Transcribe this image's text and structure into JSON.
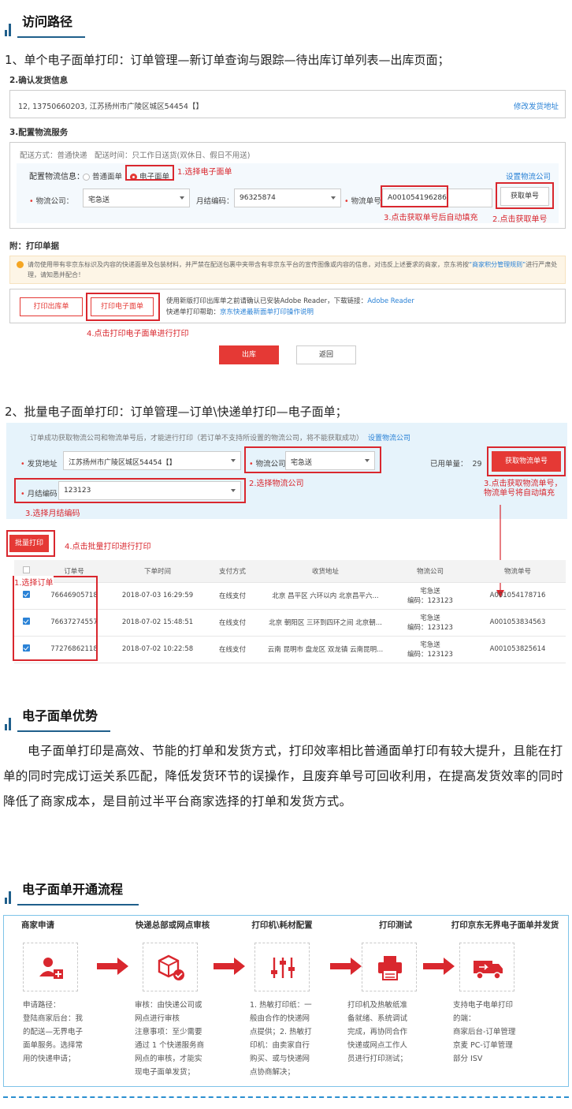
{
  "section1": {
    "title": "访问路径",
    "line1": "1、单个电子面单打印：订单管理—新订单查询与跟踪—待出库订单列表—出库页面；",
    "shot1": {
      "confirm_title": "2.确认发货信息",
      "address": "12, 13750660203, 江苏扬州市广陵区城区54454【】",
      "edit_address": "修改发货地址",
      "logistics_title": "3.配置物流服务",
      "delivery_info": "配送方式：普通快递　配送时间：只工作日送货(双休日、假日不用送)",
      "config_label": "配置物流信息：",
      "radio_normal": "普通面单",
      "radio_e": "电子面单",
      "setup_logistics": "设置物流公司",
      "company_label": "物流公司：",
      "company_value": "宅急送",
      "monthly_label": "月结编码：",
      "monthly_value": "96325874",
      "waybill_label": "物流单号：",
      "waybill_value": "A001054196286",
      "get_number": "获取单号",
      "note1": "1.选择电子面单",
      "note2": "2.点击获取单号",
      "note3": "3.点击获取单号后自动填充",
      "print_title": "附：打印单据",
      "warning": "请勿使用带有非京东标识及内容的快递面单及包装材料，并严禁在配送包裹中夹带含有非京东平台的宣传图像或内容的信息，对违反上述要求的商家，京东将按",
      "warning_link": "“商家积分管理规则”",
      "warning_tail": "进行严肃处理，请知悉并配合！",
      "print_out": "打印出库单",
      "print_e": "打印电子面单",
      "help1": "使用新版打印出库单之前请确认已安装Adobe Reader，下载链接：",
      "help1_link": "Adobe Reader",
      "help2": "快递单打印帮助：",
      "help2_link": "京东快递最新面单打印操作说明",
      "note4": "4.点击打印电子面单进行打印",
      "out_btn": "出库",
      "back_btn": "返回"
    },
    "line2": "2、批量电子面单打印：订单管理—订单\\快递单打印—电子面单；",
    "shot2": {
      "tip": "订单成功获取物流公司和物流单号后，才能进行打印（若订单不支持所设置的物流公司，将不能获取成功）",
      "tip_link": "设置物流公司",
      "ship_addr_label": "发货地址",
      "ship_addr_value": "江苏扬州市广陵区城区54454【】",
      "company_label": "物流公司",
      "company_value": "宅急送",
      "used_label": "已用单量：",
      "used_value": "29",
      "get_btn": "获取物流单号",
      "monthly_label": "月结编码",
      "monthly_value": "123123",
      "note2": "2.选择物流公司",
      "note3a": "3.点击获取物流单号，",
      "note3b": "物流单号将自动填充",
      "note3c": "3.选择月结编码",
      "batch_btn": "批量打印",
      "note4": "4.点击批量打印进行打印",
      "note1": "1.选择订单",
      "headers": [
        "订单号",
        "下单时间",
        "支付方式",
        "收货地址",
        "物流公司",
        "物流单号"
      ],
      "rows": [
        {
          "order": "76646905718",
          "time": "2018-07-03 16:29:59",
          "pay": "在线支付",
          "addr": "北京 昌平区 六环以内 北京昌平六...",
          "company": "宅急送",
          "code": "编码：123123",
          "waybill": "A001054178716"
        },
        {
          "order": "76637274557",
          "time": "2018-07-02 15:48:51",
          "pay": "在线支付",
          "addr": "北京 朝阳区 三环到四环之间 北京朝...",
          "company": "宅急送",
          "code": "编码：123123",
          "waybill": "A001053834563"
        },
        {
          "order": "77276862118",
          "time": "2018-07-02 10:22:58",
          "pay": "在线支付",
          "addr": "云南 昆明市 盘龙区 双龙镇 云南昆明...",
          "company": "宅急送",
          "code": "编码：123123",
          "waybill": "A001053825614"
        }
      ]
    }
  },
  "section2": {
    "title": "电子面单优势",
    "body": "电子面单打印是高效、节能的打单和发货方式，打印效率相比普通面单打印有较大提升，且能在打单的同时完成订运关系匹配，降低发货环节的误操作，且废弃单号可回收利用，在提高发货效率的同时降低了商家成本，是目前过半平台商家选择的打单和发货方式。"
  },
  "section3": {
    "title": "电子面单开通流程",
    "steps": [
      {
        "title": "商家申请",
        "icon": "add-user-icon",
        "text": "申请路径：\n登陆商家后台：我\n的配送—无界电子\n面单服务。选择常\n用的快递申请；"
      },
      {
        "title": "快递总部或网点审核",
        "icon": "package-check-icon",
        "text": "审核：由快递公司或\n网点进行审核\n注意事项：至少需要\n通过 1 个快递服务商\n网点的审核，才能实\n现电子面单发货；"
      },
      {
        "title": "打印机\\耗材配置",
        "icon": "settings-sliders-icon",
        "text": "1. 热敏打印纸：一\n般由合作的快递网\n点提供；2. 热敏打\n印机：由卖家自行\n购买、或与快递网\n点协商解决；"
      },
      {
        "title": "打印测试",
        "icon": "printer-icon",
        "text": "打印机及热敏纸准\n备就绪、系统调试\n完成，再协同合作\n快递或网点工作人\n员进行打印测试；"
      },
      {
        "title": "打印京东无界电子面单并发货",
        "icon": "truck-icon",
        "text": "支持电子电单打印\n的端：\n商家后台-订单管理\n京麦 PC-订单管理\n部分 ISV"
      }
    ],
    "colors": {
      "accent": "#d9272e",
      "blue": "#1f5f8b"
    }
  }
}
